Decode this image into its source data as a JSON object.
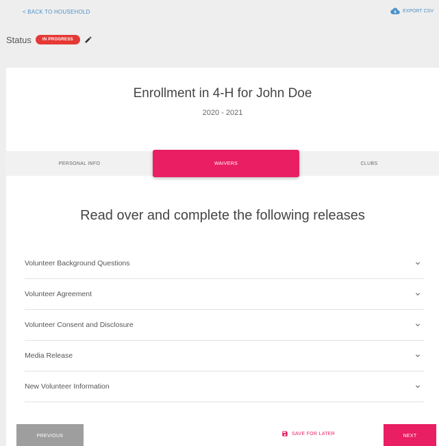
{
  "header": {
    "back_link": "< BACK TO HOUSEHOLD",
    "export_label": "EXPORT CSV",
    "export_icon": "cloud-download-icon"
  },
  "status": {
    "label": "Status",
    "badge": "IN PROGRESS",
    "badge_color": "#e53935",
    "edit_icon": "pencil-icon"
  },
  "enrollment": {
    "title": "Enrollment in 4-H for John Doe",
    "year": "2020 - 2021"
  },
  "tabs": [
    {
      "label": "PERSONAL INFO",
      "active": false
    },
    {
      "label": "WAIVERS",
      "active": true
    },
    {
      "label": "CLUBS",
      "active": false
    }
  ],
  "main": {
    "heading": "Read over and complete the following releases"
  },
  "releases": [
    {
      "label": "Volunteer Background Questions",
      "icon": "chevron-down-icon"
    },
    {
      "label": "Volunteer Agreement",
      "icon": "chevron-down-icon"
    },
    {
      "label": "Volunteer Consent and Disclosure",
      "icon": "chevron-down-icon"
    },
    {
      "label": "Media Release",
      "icon": "chevron-down-icon"
    },
    {
      "label": "New Volunteer Information",
      "icon": "chevron-down-icon"
    }
  ],
  "footer": {
    "previous": "PREVIOUS",
    "save_later": "SAVE FOR LATER",
    "save_icon": "floppy-disk-icon",
    "next": "NEXT"
  },
  "colors": {
    "accent": "#e91e63",
    "link": "#4a90c8",
    "status_red": "#e53935",
    "button_gray": "#9e9e9e"
  }
}
